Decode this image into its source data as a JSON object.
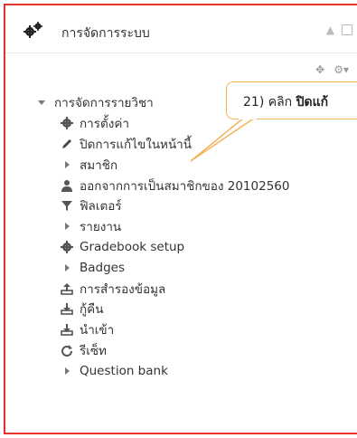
{
  "block": {
    "title": "การจัดการระบบ"
  },
  "tree": {
    "section_label": "การจัดการรายวิชา",
    "items": [
      {
        "label": "การตั้งค่า"
      },
      {
        "label": "ปิดการแก้ไขในหน้านี้"
      },
      {
        "label": "สมาชิก"
      },
      {
        "label": "ออกจากการเป็นสมาชิกของ 20102560"
      },
      {
        "label": "ฟิลเตอร์"
      },
      {
        "label": "รายงาน"
      },
      {
        "label": "Gradebook setup"
      },
      {
        "label": "Badges"
      },
      {
        "label": "การสำรองข้อมูล"
      },
      {
        "label": "กู้คืน"
      },
      {
        "label": "นำเข้า"
      },
      {
        "label": "รีเซ็ท"
      },
      {
        "label": "Question bank"
      }
    ]
  },
  "callout": {
    "prefix": "21) คลิก ",
    "bold": "ปิดแก้"
  }
}
